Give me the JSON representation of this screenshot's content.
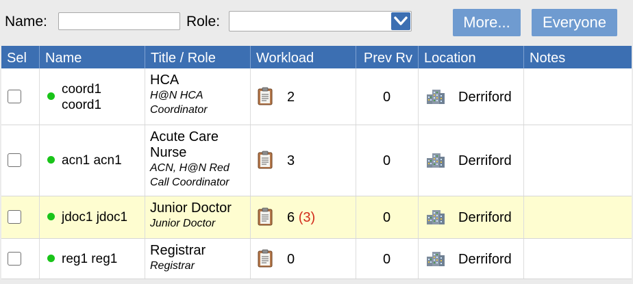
{
  "toolbar": {
    "name_label": "Name:",
    "name_value": "",
    "role_label": "Role:",
    "role_value": "",
    "more_label": "More...",
    "everyone_label": "Everyone"
  },
  "table": {
    "headers": [
      "Sel",
      "Name",
      "Title / Role",
      "Workload",
      "Prev Rv",
      "Location",
      "Notes"
    ],
    "rows": [
      {
        "name": "coord1 coord1",
        "title": "HCA",
        "subtitle": "H@N HCA Coordinator",
        "workload": "2",
        "workload_extra": "",
        "prev_rv": "0",
        "location": "Derriford",
        "notes": "",
        "status": "online",
        "highlighted": false
      },
      {
        "name": "acn1 acn1",
        "title": "Acute Care Nurse",
        "subtitle": "ACN, H@N Red Call Coordinator",
        "workload": "3",
        "workload_extra": "",
        "prev_rv": "0",
        "location": "Derriford",
        "notes": "",
        "status": "online",
        "highlighted": false
      },
      {
        "name": "jdoc1 jdoc1",
        "title": "Junior Doctor",
        "subtitle": "Junior Doctor",
        "workload": "6",
        "workload_extra": "(3)",
        "prev_rv": "0",
        "location": "Derriford",
        "notes": "",
        "status": "online",
        "highlighted": true
      },
      {
        "name": "reg1 reg1",
        "title": "Registrar",
        "subtitle": "Registrar",
        "workload": "0",
        "workload_extra": "",
        "prev_rv": "0",
        "location": "Derriford",
        "notes": "",
        "status": "online",
        "highlighted": false
      }
    ]
  },
  "colors": {
    "header_bg": "#3c6fb2",
    "button_bg": "#6f9bd0",
    "status_online": "#19c419",
    "row_highlight": "#fefdd0",
    "overdue_text": "#d22a1a"
  },
  "icons": {
    "dropdown": "chevron-down-icon",
    "workload": "clipboard-icon",
    "location": "building-icon",
    "status": "status-dot-icon"
  }
}
